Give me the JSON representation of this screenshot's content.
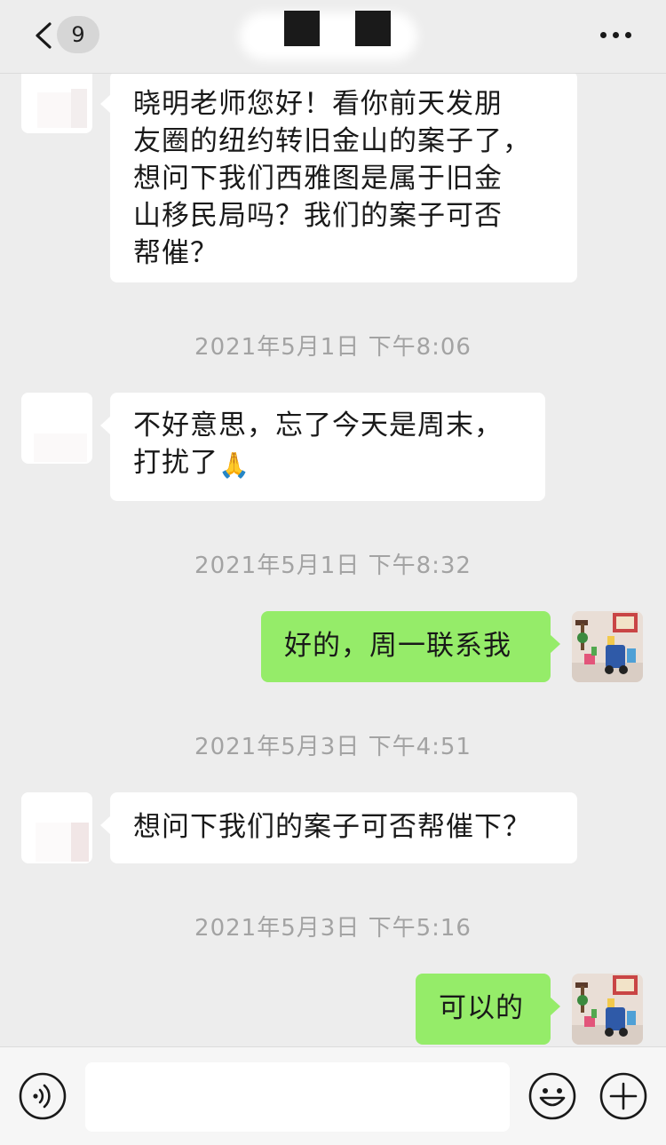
{
  "header": {
    "back_badge": "9"
  },
  "messages": [
    {
      "side": "in",
      "text": "晓明老师您好！看你前天发朋\n友圈的纽约转旧金山的案子了，\n想问下我们西雅图是属于旧金\n山移民局吗？我们的案子可否\n帮催？"
    },
    {
      "side": "in",
      "text": "不好意思，忘了今天是周末，\n打扰了",
      "emoji": "🙏"
    },
    {
      "side": "out",
      "text": "好的，周一联系我"
    },
    {
      "side": "in",
      "text": "想问下我们的案子可否帮催下？"
    },
    {
      "side": "out",
      "text": "可以的"
    }
  ],
  "timestamps": [
    "2021年5月1日 下午8:06",
    "2021年5月1日 下午8:32",
    "2021年5月3日 下午4:51",
    "2021年5月3日 下午5:16"
  ],
  "input": {
    "value": "",
    "icons": [
      "voice-icon",
      "emoji-icon",
      "plus-icon"
    ]
  },
  "colors": {
    "background": "#ededed",
    "incoming_bubble": "#ffffff",
    "outgoing_bubble": "#95ec69",
    "timestamp_text": "#a3a3a3"
  }
}
